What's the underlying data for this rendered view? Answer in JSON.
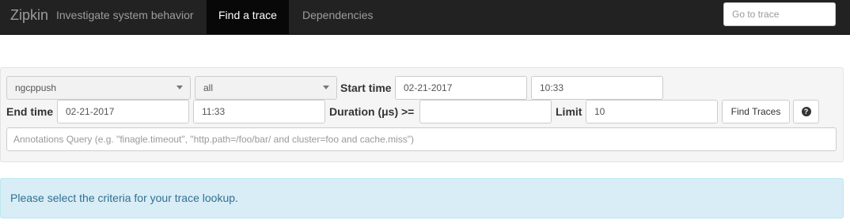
{
  "navbar": {
    "brand": "Zipkin",
    "tagline": "Investigate system behavior",
    "tabs": [
      {
        "label": "Find a trace",
        "active": true
      },
      {
        "label": "Dependencies",
        "active": false
      }
    ],
    "goto_placeholder": "Go to trace"
  },
  "search": {
    "service_value": "ngcppush",
    "span_value": "all",
    "start_time_label": "Start time",
    "start_date": "02-21-2017",
    "start_clock": "10:33",
    "end_time_label": "End time",
    "end_date": "02-21-2017",
    "end_clock": "11:33",
    "duration_label": "Duration (μs) >=",
    "duration_value": "",
    "limit_label": "Limit",
    "limit_value": "10",
    "find_button": "Find Traces",
    "help_icon": "?",
    "annotations_placeholder": "Annotations Query (e.g. \"finagle.timeout\", \"http.path=/foo/bar/ and cluster=foo and cache.miss\")"
  },
  "alert": {
    "message": "Please select the criteria for your trace lookup."
  },
  "colors": {
    "navbar_bg": "#222222",
    "active_tab_bg": "#080808",
    "alert_bg": "#d9edf7",
    "alert_text": "#31708f"
  },
  "icons": [
    "caret-down-icon",
    "question-circle-icon"
  ]
}
